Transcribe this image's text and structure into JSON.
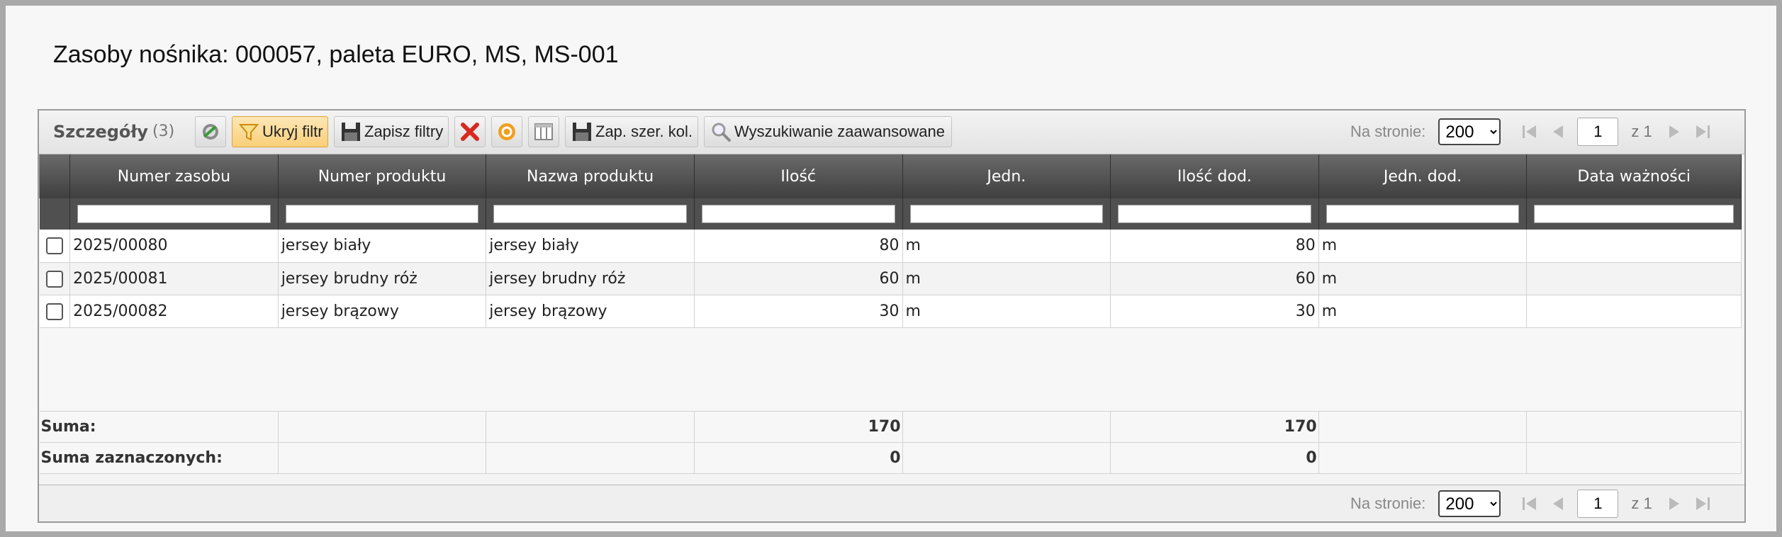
{
  "page": {
    "title": "Zasoby nośnika: 000057, paleta EURO, MS, MS-001"
  },
  "panel": {
    "title": "Szczegóły",
    "count": "(3)",
    "toolbar": {
      "hide_filter_label": "Ukryj filtr",
      "save_filters_label": "Zapisz filtry",
      "save_col_widths_label": "Zap. szer. kol.",
      "advanced_search_label": "Wyszukiwanie zaawansowane"
    },
    "pager": {
      "per_page_label": "Na stronie:",
      "per_page_value": "200",
      "page_value": "1",
      "of_label": "z 1"
    }
  },
  "columns": [
    "Numer zasobu",
    "Numer produktu",
    "Nazwa produktu",
    "Ilość",
    "Jedn.",
    "Ilość dod.",
    "Jedn. dod.",
    "Data ważności"
  ],
  "rows": [
    {
      "numer_zasobu": "2025/00080",
      "numer_produktu": "jersey biały",
      "nazwa_produktu": "jersey biały",
      "ilosc": "80",
      "jedn": "m",
      "ilosc_dod": "80",
      "jedn_dod": "m",
      "data_waznosci": ""
    },
    {
      "numer_zasobu": "2025/00081",
      "numer_produktu": "jersey brudny róż",
      "nazwa_produktu": "jersey brudny róż",
      "ilosc": "60",
      "jedn": "m",
      "ilosc_dod": "60",
      "jedn_dod": "m",
      "data_waznosci": ""
    },
    {
      "numer_zasobu": "2025/00082",
      "numer_produktu": "jersey brązowy",
      "nazwa_produktu": "jersey brązowy",
      "ilosc": "30",
      "jedn": "m",
      "ilosc_dod": "30",
      "jedn_dod": "m",
      "data_waznosci": ""
    }
  ],
  "summary": {
    "sum_label": "Suma:",
    "sum_ilosc": "170",
    "sum_ilosc_dod": "170",
    "selected_label": "Suma zaznaczonych:",
    "selected_ilosc": "0",
    "selected_ilosc_dod": "0"
  },
  "colors": {
    "header_bg": "#4f4f4f",
    "active_button": "#f9cf7a",
    "delete_icon": "#d62a1f",
    "refresh_icon": "#f0a020"
  },
  "icons": [
    "clear-filter-icon",
    "funnel-icon",
    "floppy-disk-icon",
    "delete-x-icon",
    "reset-circle-icon",
    "columns-icon",
    "magnifier-icon",
    "first-page-icon",
    "prev-page-icon",
    "next-page-icon",
    "last-page-icon"
  ]
}
